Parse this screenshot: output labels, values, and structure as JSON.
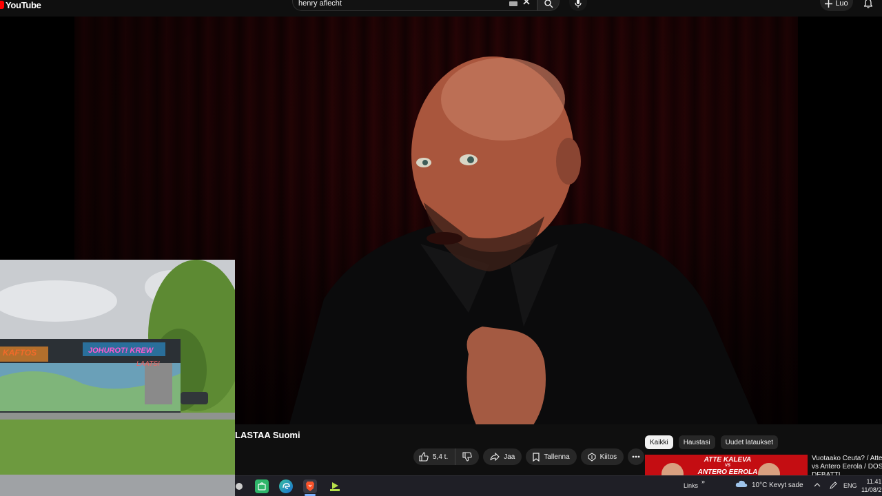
{
  "app": {
    "name": "YouTube"
  },
  "search": {
    "query": "henry aflecht"
  },
  "header": {
    "create_label": "Luo"
  },
  "video": {
    "channel_title": "LASTAA Suomi"
  },
  "actions": {
    "like_count": "5,4 t.",
    "share_label": "Jaa",
    "save_label": "Tallenna",
    "thanks_label": "Kiitos"
  },
  "chips": [
    {
      "label": "Kaikki",
      "active": true
    },
    {
      "label": "Haustasi",
      "active": false
    },
    {
      "label": "Uudet lataukset",
      "active": false
    }
  ],
  "recommendation": {
    "thumb_line1": "ATTE KALEVA",
    "thumb_line2": "VS",
    "thumb_line3": "ANTERO EEROLA",
    "title_line1": "Vuotaako Ceuta? / Atte K",
    "title_line2": "vs Antero Eerola / DOSE",
    "title_line3": "DEBATTI"
  },
  "pip": {
    "graffiti_1": "KAFTOS",
    "graffiti_2": "JOHUROT! KREW",
    "graffiti_3": "LAATSI"
  },
  "taskbar": {
    "links_label": "Links",
    "chevron": "»",
    "weather_text": "10°C  Kevyt sade",
    "language": "ENG",
    "time": "11.41",
    "date": "11/08/2"
  },
  "colors": {
    "brand_red": "#ff0000",
    "background": "#0f0f0f",
    "chip_active": "#f1f1f1"
  }
}
